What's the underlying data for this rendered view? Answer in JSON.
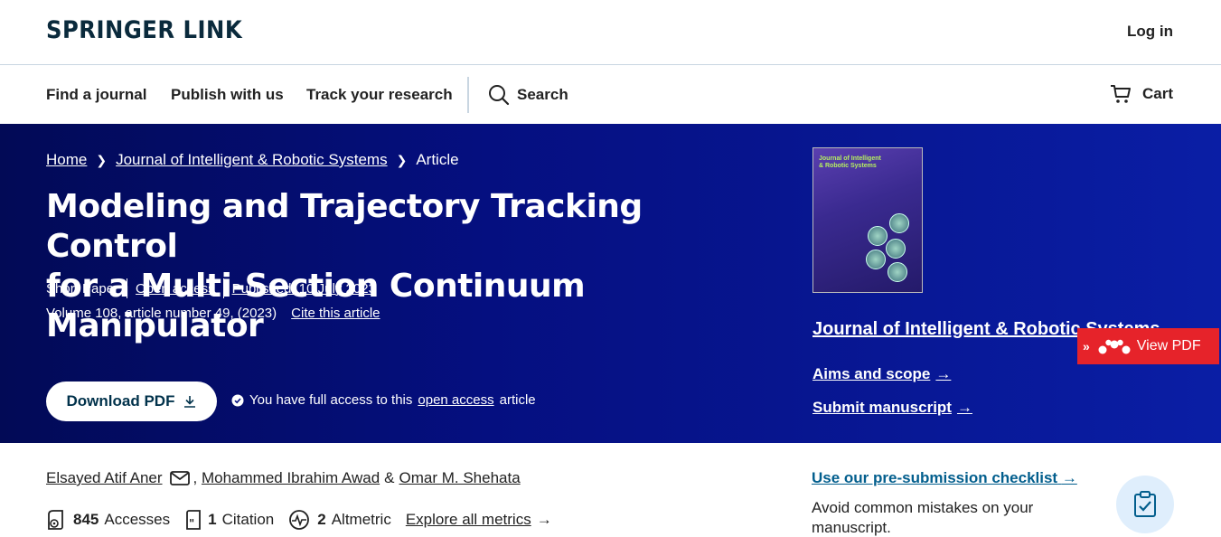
{
  "header": {
    "logo": "SPRINGER LINK",
    "login": "Log in"
  },
  "nav": {
    "find_journal": "Find a journal",
    "publish": "Publish with us",
    "track": "Track your research",
    "search": "Search",
    "cart": "Cart"
  },
  "breadcrumb": {
    "home": "Home",
    "journal": "Journal of Intelligent & Robotic Systems",
    "article": "Article"
  },
  "article": {
    "title_line1": "Modeling and Trajectory Tracking Control",
    "title_line2": "for a Multi-Section Continuum Manipulator",
    "type": "Short Paper",
    "open_access": "Open access",
    "published": "Published: 10 July 2023",
    "volume": "Volume 108, article number 49, (2023)",
    "cite": "Cite this article",
    "download_pdf": "Download PDF",
    "access_prefix": "You have full access to this",
    "access_link": "open access",
    "access_suffix": "article"
  },
  "journal_panel": {
    "cover_title": "Journal of Intelligent & Robotic Systems",
    "journal_name": "Journal of Intelligent & Robotic Systems",
    "aims": "Aims and scope",
    "submit": "Submit manuscript",
    "view_pdf": "View PDF"
  },
  "authors": {
    "a1": "Elsayed Atif Aner",
    "a2": "Mohammed Ibrahim Awad",
    "amp": "&",
    "a3": "Omar M. Shehata"
  },
  "metrics": {
    "accesses_num": "845",
    "accesses_label": "Accesses",
    "citation_num": "1",
    "citation_label": "Citation",
    "altmetric_num": "2",
    "altmetric_label": "Altmetric",
    "explore": "Explore all metrics"
  },
  "sidebar": {
    "checklist": "Use our pre-submission checklist",
    "avoid": "Avoid common mistakes on your manuscript."
  },
  "colors": {
    "hero_dark": "#020a56",
    "hero_light": "#0a1ea5",
    "link_blue": "#025e8d",
    "view_pdf_red": "#e6232a"
  }
}
